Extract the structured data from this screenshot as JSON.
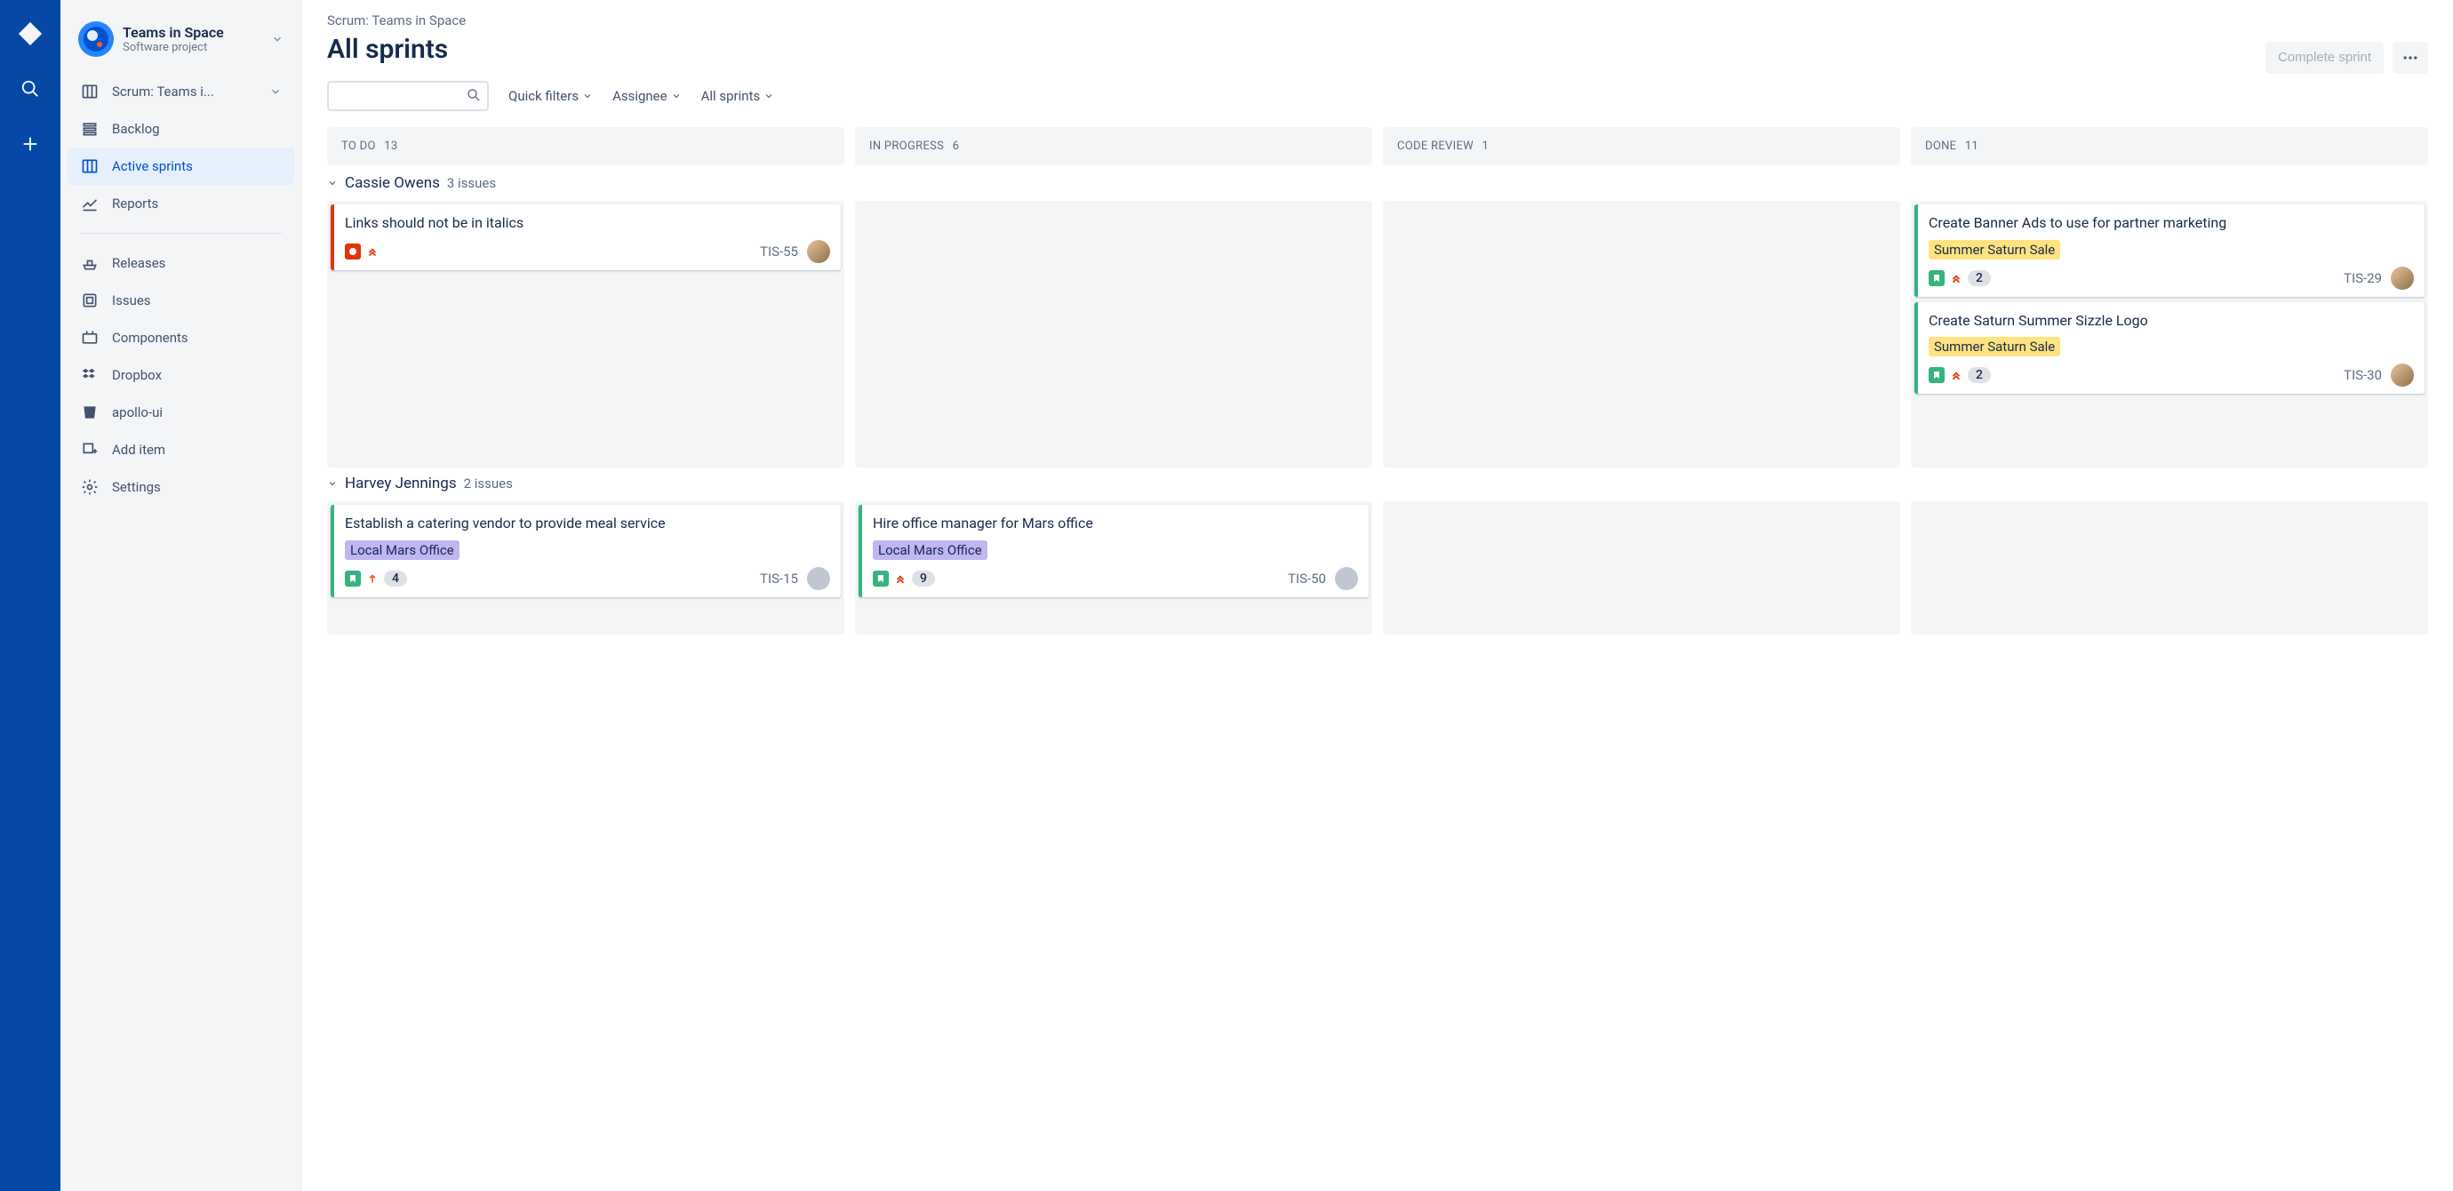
{
  "rail": {
    "icons": [
      "jira-logo",
      "search",
      "create"
    ]
  },
  "project": {
    "name": "Teams in Space",
    "type": "Software project"
  },
  "sidebar": {
    "board_selector": "Scrum: Teams i...",
    "nav1": [
      {
        "icon": "backlog",
        "label": "Backlog"
      },
      {
        "icon": "board",
        "label": "Active sprints",
        "active": true
      },
      {
        "icon": "reports",
        "label": "Reports"
      }
    ],
    "nav2": [
      {
        "icon": "releases",
        "label": "Releases"
      },
      {
        "icon": "issues",
        "label": "Issues"
      },
      {
        "icon": "components",
        "label": "Components"
      },
      {
        "icon": "dropbox",
        "label": "Dropbox"
      },
      {
        "icon": "bitbucket",
        "label": "apollo-ui"
      },
      {
        "icon": "add",
        "label": "Add item"
      },
      {
        "icon": "settings",
        "label": "Settings"
      }
    ]
  },
  "breadcrumb": "Scrum: Teams in Space",
  "page_title": "All sprints",
  "header": {
    "complete": "Complete sprint"
  },
  "filters": {
    "quick": "Quick filters",
    "assignee": "Assignee",
    "sprints": "All sprints"
  },
  "columns": [
    {
      "name": "TO DO",
      "count": "13"
    },
    {
      "name": "IN PROGRESS",
      "count": "6"
    },
    {
      "name": "CODE REVIEW",
      "count": "1"
    },
    {
      "name": "DONE",
      "count": "11"
    }
  ],
  "swimlanes": [
    {
      "name": "Cassie Owens",
      "issues": "3 issues",
      "rows": {
        "todo": [
          {
            "title": "Links should not be in italics",
            "type": "bug",
            "priority": "highest",
            "key": "TIS-55"
          }
        ],
        "inprogress": [],
        "codereview": [],
        "done": [
          {
            "title": "Create Banner Ads to use for partner marketing",
            "type": "story",
            "priority": "highest",
            "label": "Summer Saturn Sale",
            "labelClass": "yellow",
            "count": "2",
            "key": "TIS-29"
          },
          {
            "title": "Create Saturn Summer Sizzle Logo",
            "type": "story",
            "priority": "highest",
            "label": "Summer Saturn Sale",
            "labelClass": "yellow",
            "count": "2",
            "key": "TIS-30"
          }
        ]
      }
    },
    {
      "name": "Harvey Jennings",
      "issues": "2 issues",
      "rows": {
        "todo": [
          {
            "title": "Establish a catering vendor to provide meal service",
            "type": "story",
            "priority": "medium",
            "label": "Local Mars Office",
            "labelClass": "purple",
            "count": "4",
            "key": "TIS-15"
          }
        ],
        "inprogress": [
          {
            "title": "Hire office manager for Mars office",
            "type": "story",
            "priority": "highest",
            "label": "Local Mars Office",
            "labelClass": "purple",
            "count": "9",
            "key": "TIS-50"
          }
        ],
        "codereview": [],
        "done": []
      }
    }
  ]
}
